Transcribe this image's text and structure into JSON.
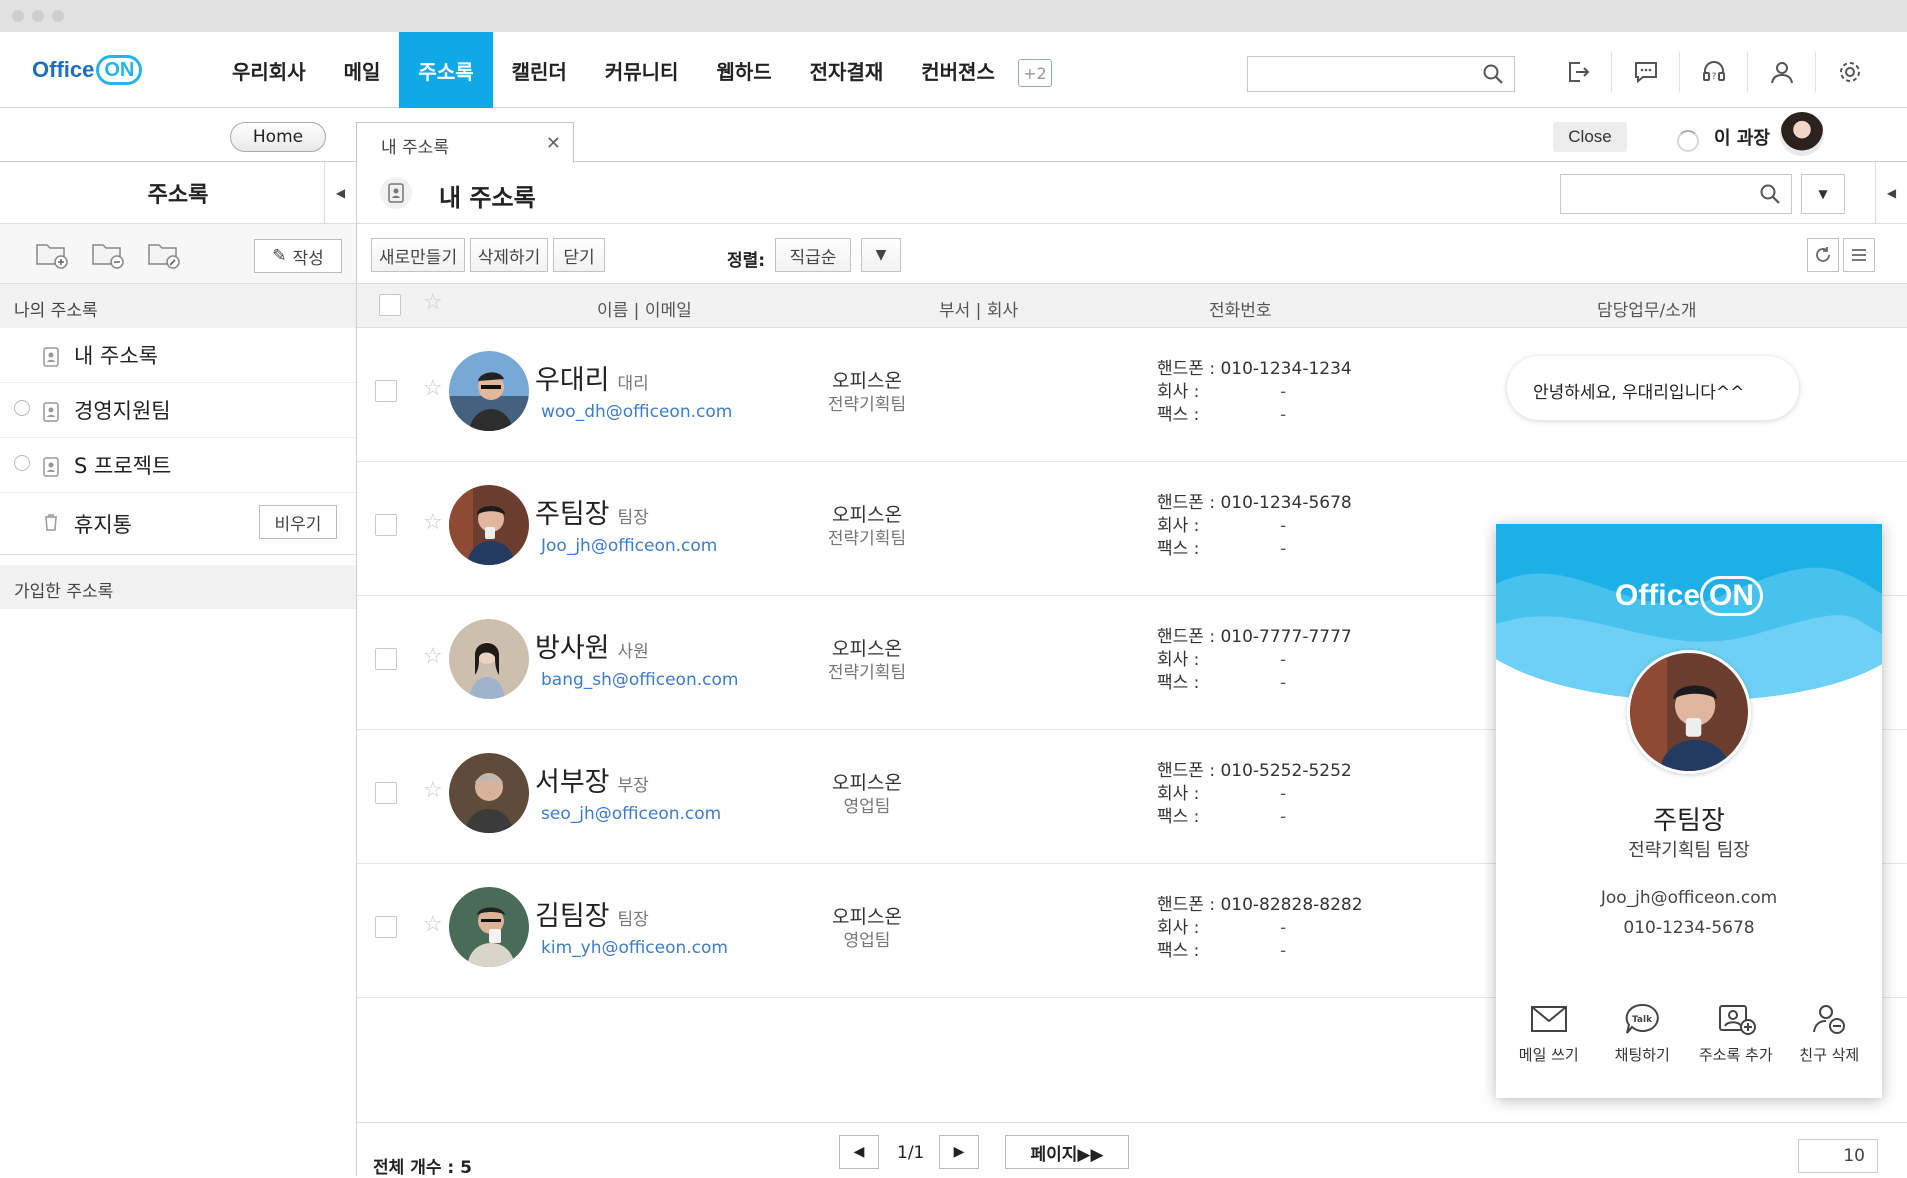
{
  "app": {
    "logo_text": "Office",
    "logo_on": "ON",
    "brand_color": "#10a9e8"
  },
  "nav": {
    "items": [
      {
        "label": "우리회사"
      },
      {
        "label": "메일"
      },
      {
        "label": "주소록",
        "active": true
      },
      {
        "label": "캘린더"
      },
      {
        "label": "커뮤니티"
      },
      {
        "label": "웹하드"
      },
      {
        "label": "전자결재"
      },
      {
        "label": "컨버젼스"
      }
    ],
    "more_label": "+2",
    "search_placeholder": "",
    "icons": [
      "logout-icon",
      "message-icon",
      "support-icon",
      "user-icon",
      "settings-icon"
    ]
  },
  "tabs": {
    "home_label": "Home",
    "open_tab_label": "내 주소록",
    "close_label": "Close",
    "user_name": "이 과장"
  },
  "sidebar": {
    "title": "주소록",
    "write_label": "작성",
    "section_mine": "나의 주소록",
    "items": [
      {
        "label": "내 주소록",
        "icon": "address-book-icon"
      },
      {
        "label": "경영지원팀",
        "icon": "address-book-icon"
      },
      {
        "label": "S 프로젝트",
        "icon": "address-book-icon"
      },
      {
        "label": "휴지통",
        "icon": "trash-icon"
      }
    ],
    "empty_label": "비우기",
    "section_joined": "가입한 주소록"
  },
  "main": {
    "title": "내 주소록",
    "search_placeholder": "",
    "toolbar": {
      "new_label": "새로만들기",
      "delete_label": "삭제하기",
      "close_label": "닫기",
      "sort_label": "정렬:",
      "sort_value": "직급순"
    },
    "columns": {
      "name_email": "이름 | 이메일",
      "dept_company": "부서 | 회사",
      "phone": "전화번호",
      "intro": "담당업무/소개"
    },
    "phone_labels": {
      "mobile": "핸드폰 :",
      "office": "회사 :",
      "fax": "팩스 :",
      "empty": "-"
    },
    "contacts": [
      {
        "name": "우대리",
        "position": "대리",
        "email": "woo_dh@officeon.com",
        "company": "오피스온",
        "dept": "전략기획팀",
        "mobile": "010-1234-1234",
        "intro": "안녕하세요, 우대리입니다^^"
      },
      {
        "name": "주팀장",
        "position": "팀장",
        "email": "Joo_jh@officeon.com",
        "company": "오피스온",
        "dept": "전략기획팀",
        "mobile": "010-1234-5678"
      },
      {
        "name": "방사원",
        "position": "사원",
        "email": "bang_sh@officeon.com",
        "company": "오피스온",
        "dept": "전략기획팀",
        "mobile": "010-7777-7777"
      },
      {
        "name": "서부장",
        "position": "부장",
        "email": "seo_jh@officeon.com",
        "company": "오피스온",
        "dept": "영업팀",
        "mobile": "010-5252-5252"
      },
      {
        "name": "김팀장",
        "position": "팀장",
        "email": "kim_yh@officeon.com",
        "company": "오피스온",
        "dept": "영업팀",
        "mobile": "010-82828-8282"
      }
    ],
    "footer": {
      "total_label": "전체 개수 : 5",
      "page_info": "1/1",
      "page_go_label": "페이지▶▶",
      "per_page": "10"
    }
  },
  "profile_card": {
    "logo_text": "Office",
    "logo_on": "ON",
    "name": "주팀장",
    "dept_position": "전략기획팀 팀장",
    "email": "Joo_jh@officeon.com",
    "phone": "010-1234-5678",
    "actions": [
      {
        "label": "메일 쓰기",
        "icon": "mail-icon"
      },
      {
        "label": "채팅하기",
        "icon": "talk-icon"
      },
      {
        "label": "주소록 추가",
        "icon": "add-address-icon"
      },
      {
        "label": "친구 삭제",
        "icon": "remove-friend-icon"
      }
    ]
  }
}
